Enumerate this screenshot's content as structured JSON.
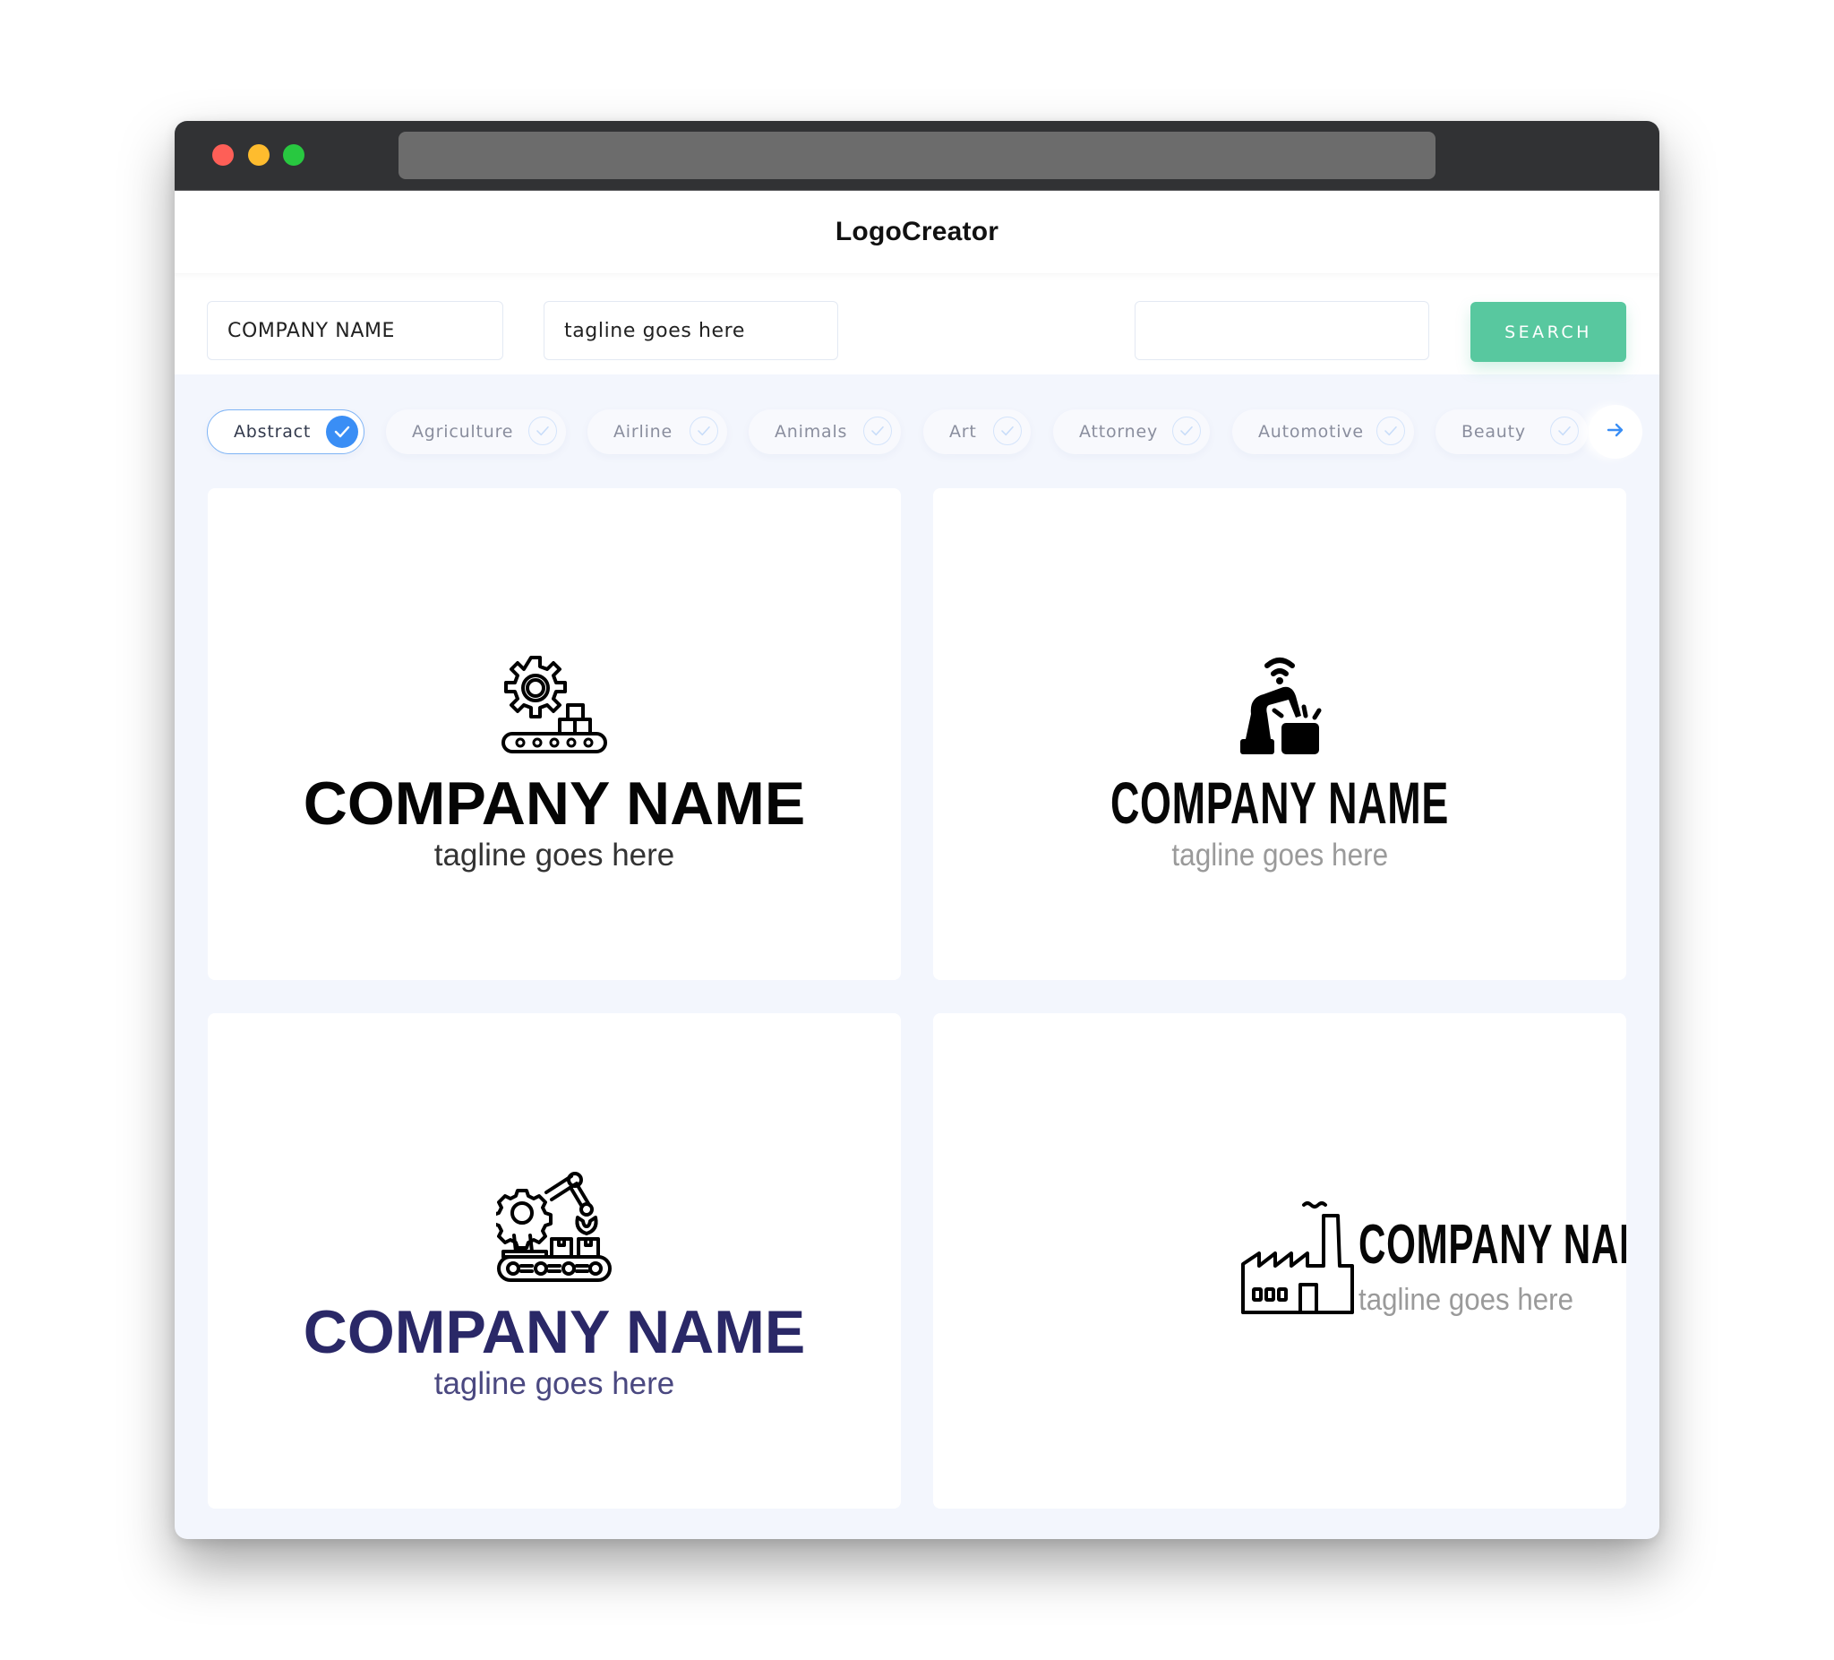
{
  "window": {
    "traffic_lights": [
      "close",
      "minimize",
      "maximize"
    ],
    "colors": {
      "close": "#fe5f57",
      "minimize": "#febc2e",
      "maximize": "#28c840"
    }
  },
  "header": {
    "title": "LogoCreator"
  },
  "search": {
    "company_name_value": "COMPANY NAME",
    "tagline_value": "tagline goes here",
    "extra_value": "",
    "button_label": "SEARCH",
    "button_color": "#58c89f"
  },
  "categories": {
    "items": [
      {
        "label": "Abstract",
        "selected": true
      },
      {
        "label": "Agriculture",
        "selected": false
      },
      {
        "label": "Airline",
        "selected": false
      },
      {
        "label": "Animals",
        "selected": false
      },
      {
        "label": "Art",
        "selected": false
      },
      {
        "label": "Attorney",
        "selected": false
      },
      {
        "label": "Automotive",
        "selected": false
      },
      {
        "label": "Beauty",
        "selected": false
      }
    ],
    "next_icon": "arrow-right-icon",
    "accent_color": "#3a8ef5"
  },
  "logos": [
    {
      "icon": "gear-conveyor-boxes-icon",
      "company_name": "COMPANY NAME",
      "tagline": "tagline goes here",
      "name_color": "#050505",
      "tagline_color": "#333333"
    },
    {
      "icon": "robot-arm-wifi-icon",
      "company_name": "COMPANY NAME",
      "tagline": "tagline goes here",
      "name_color": "#070707",
      "tagline_color": "#9a9a9a"
    },
    {
      "icon": "robotic-arm-gear-conveyor-icon",
      "company_name": "COMPANY NAME",
      "tagline": "tagline goes here",
      "name_color": "#2a2867",
      "tagline_color": "#4a4880"
    },
    {
      "icon": "factory-icon",
      "company_name": "COMPANY NAME",
      "tagline": "tagline goes here",
      "name_color": "#070707",
      "tagline_color": "#9a9a9a"
    }
  ]
}
